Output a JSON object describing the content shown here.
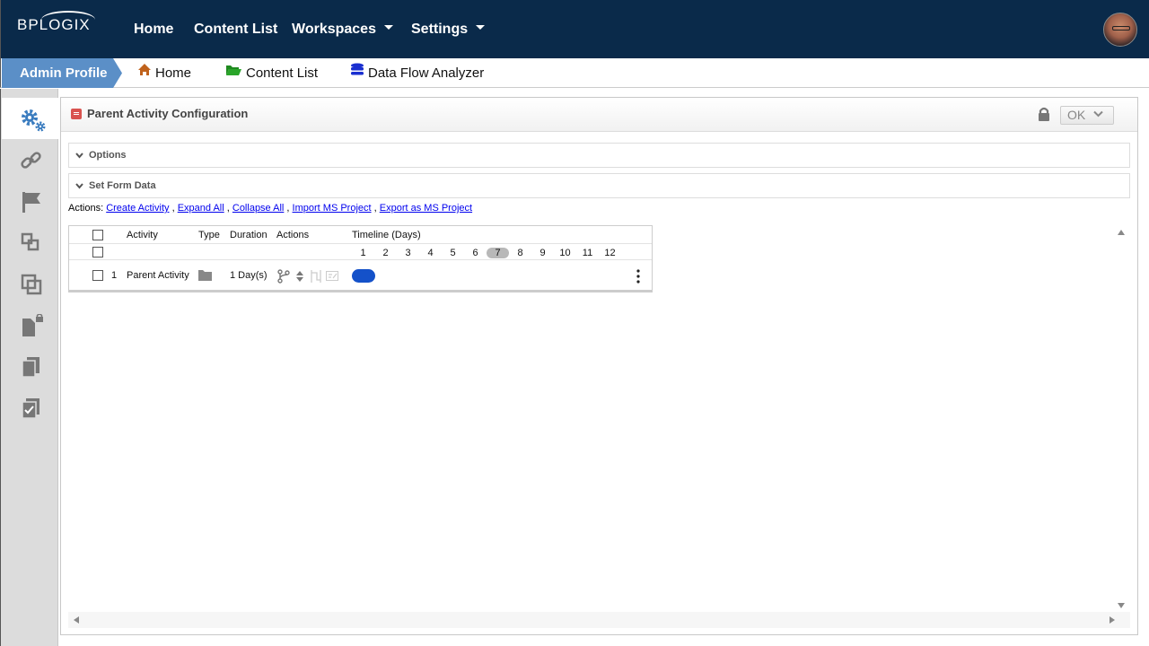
{
  "brand": {
    "logo_text": "BPLOGIX"
  },
  "topnav": {
    "items": [
      {
        "label": "Home"
      },
      {
        "label": "Content List"
      },
      {
        "label": "Workspaces"
      },
      {
        "label": "Settings"
      }
    ]
  },
  "breadcrumb": {
    "profile": "Admin Profile",
    "items": [
      {
        "label": "Home",
        "icon": "home-icon"
      },
      {
        "label": "Content List",
        "icon": "folder-open-icon"
      },
      {
        "label": "Data Flow Analyzer",
        "icon": "database-icon"
      }
    ]
  },
  "sidebar": {
    "items": [
      {
        "icon": "gears-icon",
        "active": true
      },
      {
        "icon": "link-icon"
      },
      {
        "icon": "flag-icon"
      },
      {
        "icon": "shapes-icon"
      },
      {
        "icon": "clone-icon"
      },
      {
        "icon": "locked-document-icon"
      },
      {
        "icon": "copy-icon"
      },
      {
        "icon": "checked-document-icon"
      }
    ]
  },
  "panel": {
    "title": "Parent Activity Configuration",
    "ok_label": "OK",
    "sections": [
      {
        "label": "Options"
      },
      {
        "label": "Set Form Data"
      }
    ],
    "actions_prefix": "Actions:",
    "actions": [
      "Create Activity",
      "Expand All",
      "Collapse All",
      "Import MS Project",
      "Export as MS Project"
    ],
    "actions_separator": ","
  },
  "grid": {
    "columns": {
      "activity": "Activity",
      "type": "Type",
      "duration": "Duration",
      "actions": "Actions",
      "timeline": "Timeline (Days)"
    },
    "days": [
      "1",
      "2",
      "3",
      "4",
      "5",
      "6",
      "7",
      "8",
      "9",
      "10",
      "11",
      "12"
    ],
    "current_day": "7",
    "rows": [
      {
        "num": "1",
        "activity": "Parent Activity",
        "type_icon": "folder-icon",
        "duration": "1 Day(s)"
      }
    ]
  },
  "colors": {
    "topnav_bg": "#0a2a4a",
    "profile_crumb": "#5b8fc7",
    "timeline_bar": "#1451c9",
    "link": "#0000ee"
  }
}
